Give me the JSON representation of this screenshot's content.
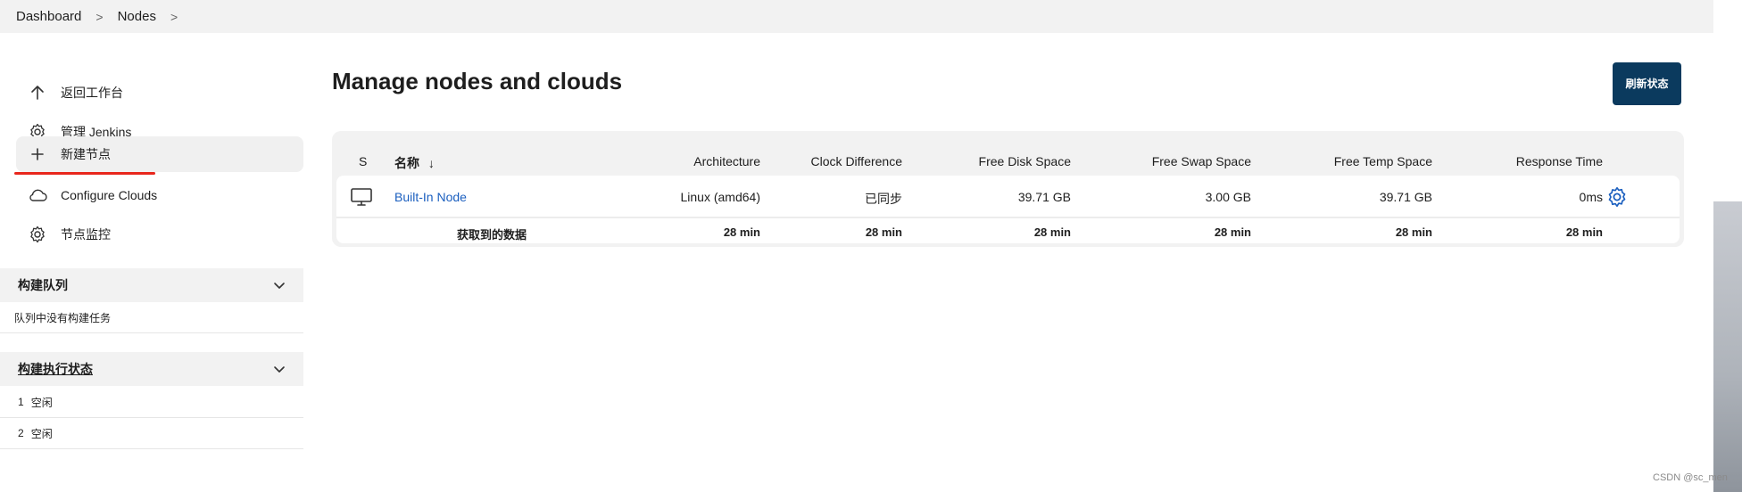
{
  "breadcrumb": {
    "items": [
      "Dashboard",
      "Nodes"
    ],
    "separator": ">"
  },
  "sidebar": {
    "tasks": [
      {
        "label": "返回工作台",
        "icon": "arrow-up-icon"
      },
      {
        "label": "管理 Jenkins",
        "icon": "gear-icon"
      },
      {
        "label": "新建节点",
        "icon": "plus-icon"
      },
      {
        "label": "Configure Clouds",
        "icon": "cloud-icon"
      },
      {
        "label": "节点监控",
        "icon": "gear-icon"
      }
    ],
    "build_queue": {
      "title": "构建队列",
      "empty_text": "队列中没有构建任务"
    },
    "executors": {
      "title": "构建执行状态",
      "items": [
        {
          "num": "1",
          "status": "空闲"
        },
        {
          "num": "2",
          "status": "空闲"
        }
      ]
    }
  },
  "main": {
    "title": "Manage nodes and clouds",
    "refresh_button": "刷新状态",
    "table": {
      "headers": {
        "s": "S",
        "name": "名称",
        "sort_arrow": "↓",
        "architecture": "Architecture",
        "clock": "Clock Difference",
        "disk": "Free Disk Space",
        "swap": "Free Swap Space",
        "temp": "Free Temp Space",
        "response": "Response Time"
      },
      "rows": [
        {
          "icon": "computer-icon",
          "name": "Built-In Node",
          "architecture": "Linux (amd64)",
          "clock": "已同步",
          "disk": "39.71 GB",
          "swap": "3.00 GB",
          "temp": "39.71 GB",
          "response": "0ms"
        }
      ],
      "footer": {
        "label": "获取到的数据",
        "architecture": "28 min",
        "clock": "28 min",
        "disk": "28 min",
        "swap": "28 min",
        "temp": "28 min",
        "response": "28 min"
      }
    }
  },
  "watermark": "CSDN @sc_men",
  "colors": {
    "accent": "#0b3a5e",
    "link": "#1b5fbf",
    "underline": "#e8261c",
    "settings_icon": "#1b5fbf"
  }
}
